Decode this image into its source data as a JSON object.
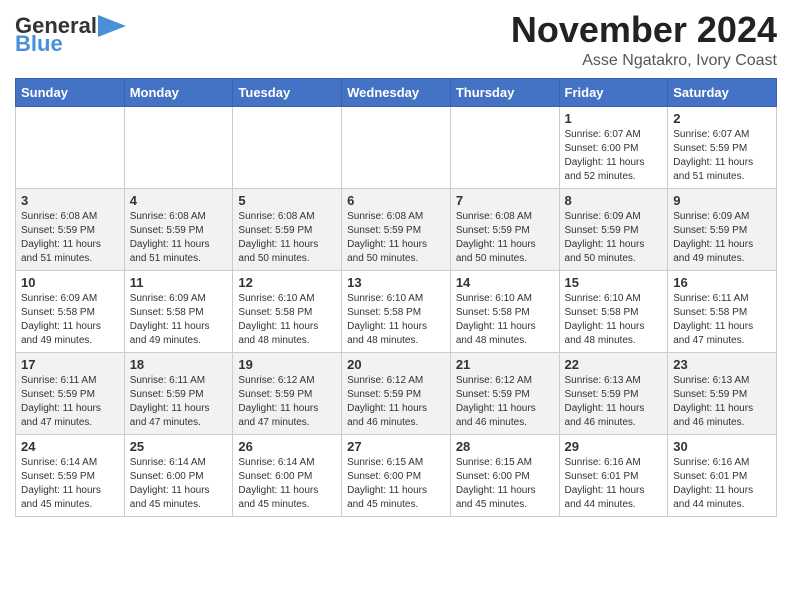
{
  "header": {
    "logo_general": "General",
    "logo_blue": "Blue",
    "title": "November 2024",
    "subtitle": "Asse Ngatakro, Ivory Coast"
  },
  "weekdays": [
    "Sunday",
    "Monday",
    "Tuesday",
    "Wednesday",
    "Thursday",
    "Friday",
    "Saturday"
  ],
  "weeks": [
    [
      {
        "day": "",
        "info": ""
      },
      {
        "day": "",
        "info": ""
      },
      {
        "day": "",
        "info": ""
      },
      {
        "day": "",
        "info": ""
      },
      {
        "day": "",
        "info": ""
      },
      {
        "day": "1",
        "info": "Sunrise: 6:07 AM\nSunset: 6:00 PM\nDaylight: 11 hours\nand 52 minutes."
      },
      {
        "day": "2",
        "info": "Sunrise: 6:07 AM\nSunset: 5:59 PM\nDaylight: 11 hours\nand 51 minutes."
      }
    ],
    [
      {
        "day": "3",
        "info": "Sunrise: 6:08 AM\nSunset: 5:59 PM\nDaylight: 11 hours\nand 51 minutes."
      },
      {
        "day": "4",
        "info": "Sunrise: 6:08 AM\nSunset: 5:59 PM\nDaylight: 11 hours\nand 51 minutes."
      },
      {
        "day": "5",
        "info": "Sunrise: 6:08 AM\nSunset: 5:59 PM\nDaylight: 11 hours\nand 50 minutes."
      },
      {
        "day": "6",
        "info": "Sunrise: 6:08 AM\nSunset: 5:59 PM\nDaylight: 11 hours\nand 50 minutes."
      },
      {
        "day": "7",
        "info": "Sunrise: 6:08 AM\nSunset: 5:59 PM\nDaylight: 11 hours\nand 50 minutes."
      },
      {
        "day": "8",
        "info": "Sunrise: 6:09 AM\nSunset: 5:59 PM\nDaylight: 11 hours\nand 50 minutes."
      },
      {
        "day": "9",
        "info": "Sunrise: 6:09 AM\nSunset: 5:59 PM\nDaylight: 11 hours\nand 49 minutes."
      }
    ],
    [
      {
        "day": "10",
        "info": "Sunrise: 6:09 AM\nSunset: 5:58 PM\nDaylight: 11 hours\nand 49 minutes."
      },
      {
        "day": "11",
        "info": "Sunrise: 6:09 AM\nSunset: 5:58 PM\nDaylight: 11 hours\nand 49 minutes."
      },
      {
        "day": "12",
        "info": "Sunrise: 6:10 AM\nSunset: 5:58 PM\nDaylight: 11 hours\nand 48 minutes."
      },
      {
        "day": "13",
        "info": "Sunrise: 6:10 AM\nSunset: 5:58 PM\nDaylight: 11 hours\nand 48 minutes."
      },
      {
        "day": "14",
        "info": "Sunrise: 6:10 AM\nSunset: 5:58 PM\nDaylight: 11 hours\nand 48 minutes."
      },
      {
        "day": "15",
        "info": "Sunrise: 6:10 AM\nSunset: 5:58 PM\nDaylight: 11 hours\nand 48 minutes."
      },
      {
        "day": "16",
        "info": "Sunrise: 6:11 AM\nSunset: 5:58 PM\nDaylight: 11 hours\nand 47 minutes."
      }
    ],
    [
      {
        "day": "17",
        "info": "Sunrise: 6:11 AM\nSunset: 5:59 PM\nDaylight: 11 hours\nand 47 minutes."
      },
      {
        "day": "18",
        "info": "Sunrise: 6:11 AM\nSunset: 5:59 PM\nDaylight: 11 hours\nand 47 minutes."
      },
      {
        "day": "19",
        "info": "Sunrise: 6:12 AM\nSunset: 5:59 PM\nDaylight: 11 hours\nand 47 minutes."
      },
      {
        "day": "20",
        "info": "Sunrise: 6:12 AM\nSunset: 5:59 PM\nDaylight: 11 hours\nand 46 minutes."
      },
      {
        "day": "21",
        "info": "Sunrise: 6:12 AM\nSunset: 5:59 PM\nDaylight: 11 hours\nand 46 minutes."
      },
      {
        "day": "22",
        "info": "Sunrise: 6:13 AM\nSunset: 5:59 PM\nDaylight: 11 hours\nand 46 minutes."
      },
      {
        "day": "23",
        "info": "Sunrise: 6:13 AM\nSunset: 5:59 PM\nDaylight: 11 hours\nand 46 minutes."
      }
    ],
    [
      {
        "day": "24",
        "info": "Sunrise: 6:14 AM\nSunset: 5:59 PM\nDaylight: 11 hours\nand 45 minutes."
      },
      {
        "day": "25",
        "info": "Sunrise: 6:14 AM\nSunset: 6:00 PM\nDaylight: 11 hours\nand 45 minutes."
      },
      {
        "day": "26",
        "info": "Sunrise: 6:14 AM\nSunset: 6:00 PM\nDaylight: 11 hours\nand 45 minutes."
      },
      {
        "day": "27",
        "info": "Sunrise: 6:15 AM\nSunset: 6:00 PM\nDaylight: 11 hours\nand 45 minutes."
      },
      {
        "day": "28",
        "info": "Sunrise: 6:15 AM\nSunset: 6:00 PM\nDaylight: 11 hours\nand 45 minutes."
      },
      {
        "day": "29",
        "info": "Sunrise: 6:16 AM\nSunset: 6:01 PM\nDaylight: 11 hours\nand 44 minutes."
      },
      {
        "day": "30",
        "info": "Sunrise: 6:16 AM\nSunset: 6:01 PM\nDaylight: 11 hours\nand 44 minutes."
      }
    ]
  ]
}
